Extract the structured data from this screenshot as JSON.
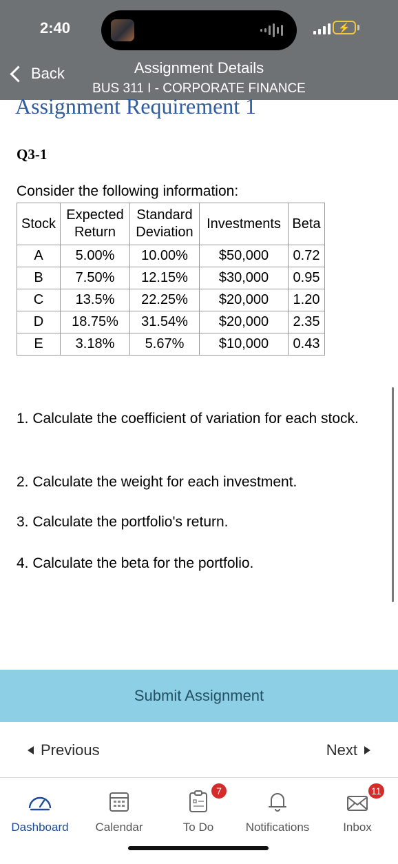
{
  "status_bar": {
    "time": "2:40"
  },
  "nav": {
    "back_label": "Back",
    "title": "Assignment Details",
    "subtitle": "BUS 311 I - CORPORATE FINANCE"
  },
  "content": {
    "heading": "Assignment Requirement 1",
    "question_label": "Q3-1",
    "intro": "Consider the following information:",
    "table": {
      "headers": {
        "stock": "Stock",
        "expected_return": "Expected Return",
        "standard_deviation": "Standard Deviation",
        "investments": "Investments",
        "beta": "Beta"
      },
      "rows": [
        {
          "stock": "A",
          "expected_return": "5.00%",
          "standard_deviation": "10.00%",
          "investments": "$50,000",
          "beta": "0.72"
        },
        {
          "stock": "B",
          "expected_return": "7.50%",
          "standard_deviation": "12.15%",
          "investments": "$30,000",
          "beta": "0.95"
        },
        {
          "stock": "C",
          "expected_return": "13.5%",
          "standard_deviation": "22.25%",
          "investments": "$20,000",
          "beta": "1.20"
        },
        {
          "stock": "D",
          "expected_return": "18.75%",
          "standard_deviation": "31.54%",
          "investments": "$20,000",
          "beta": "2.35"
        },
        {
          "stock": "E",
          "expected_return": "3.18%",
          "standard_deviation": "5.67%",
          "investments": "$10,000",
          "beta": "0.43"
        }
      ]
    },
    "tasks": [
      "1. Calculate the coefficient of variation for each stock.",
      "2. Calculate the weight for each investment.",
      "3. Calculate the portfolio's return.",
      "4. Calculate the beta for the portfolio."
    ]
  },
  "submit_label": "Submit Assignment",
  "pager": {
    "previous_label": "Previous",
    "next_label": "Next"
  },
  "tabs": [
    {
      "label": "Dashboard",
      "icon": "dashboard-gauge-icon",
      "active": true
    },
    {
      "label": "Calendar",
      "icon": "calendar-icon"
    },
    {
      "label": "To Do",
      "icon": "todo-list-icon",
      "badge": "7"
    },
    {
      "label": "Notifications",
      "icon": "bell-icon"
    },
    {
      "label": "Inbox",
      "icon": "envelope-icon",
      "badge": "11"
    }
  ],
  "colors": {
    "header_bg": "#6f7275",
    "heading": "#2f5d9e",
    "submit_bg": "#8dd0e6",
    "active_tab": "#1b4b9b",
    "badge": "#d62b2b",
    "battery": "#f0c83c"
  }
}
